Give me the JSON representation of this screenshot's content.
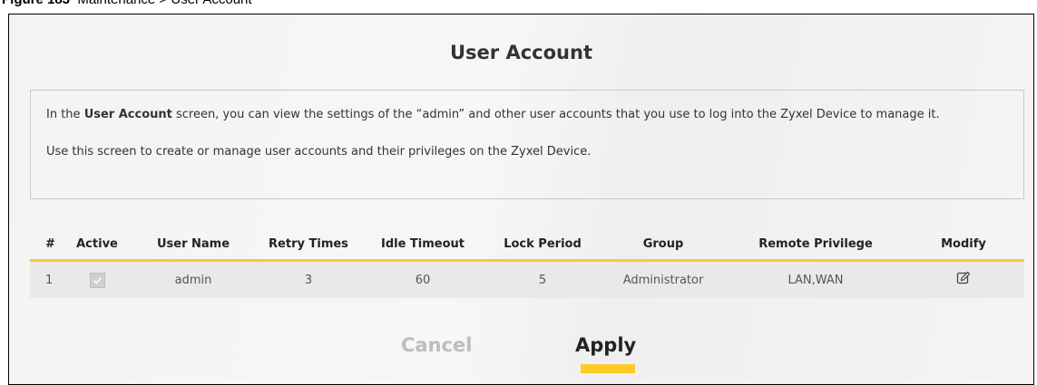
{
  "figure_caption": {
    "label": "Figure 183",
    "text": "Maintenance > User Account"
  },
  "page": {
    "title": "User Account"
  },
  "info": {
    "line1_prefix": "In the ",
    "line1_bold": "User Account",
    "line1_suffix": " screen, you can view the settings of the “admin” and other user accounts that you use to log into the Zyxel Device to manage it.",
    "line2": "Use this screen to create or manage user accounts and their privileges on the Zyxel Device."
  },
  "table": {
    "headers": [
      "#",
      "Active",
      "User Name",
      "Retry Times",
      "Idle Timeout",
      "Lock Period",
      "Group",
      "Remote Privilege",
      "Modify"
    ],
    "rows": [
      {
        "index": "1",
        "active": true,
        "user_name": "admin",
        "retry_times": "3",
        "idle_timeout": "60",
        "lock_period": "5",
        "group": "Administrator",
        "remote_privilege": "LAN,WAN",
        "modify_icon": "edit-icon"
      }
    ]
  },
  "buttons": {
    "cancel": "Cancel",
    "apply": "Apply"
  },
  "colors": {
    "accent": "#ffca28",
    "row_bg": "#e9e9e9",
    "cancel_text": "#bdbdbd"
  }
}
